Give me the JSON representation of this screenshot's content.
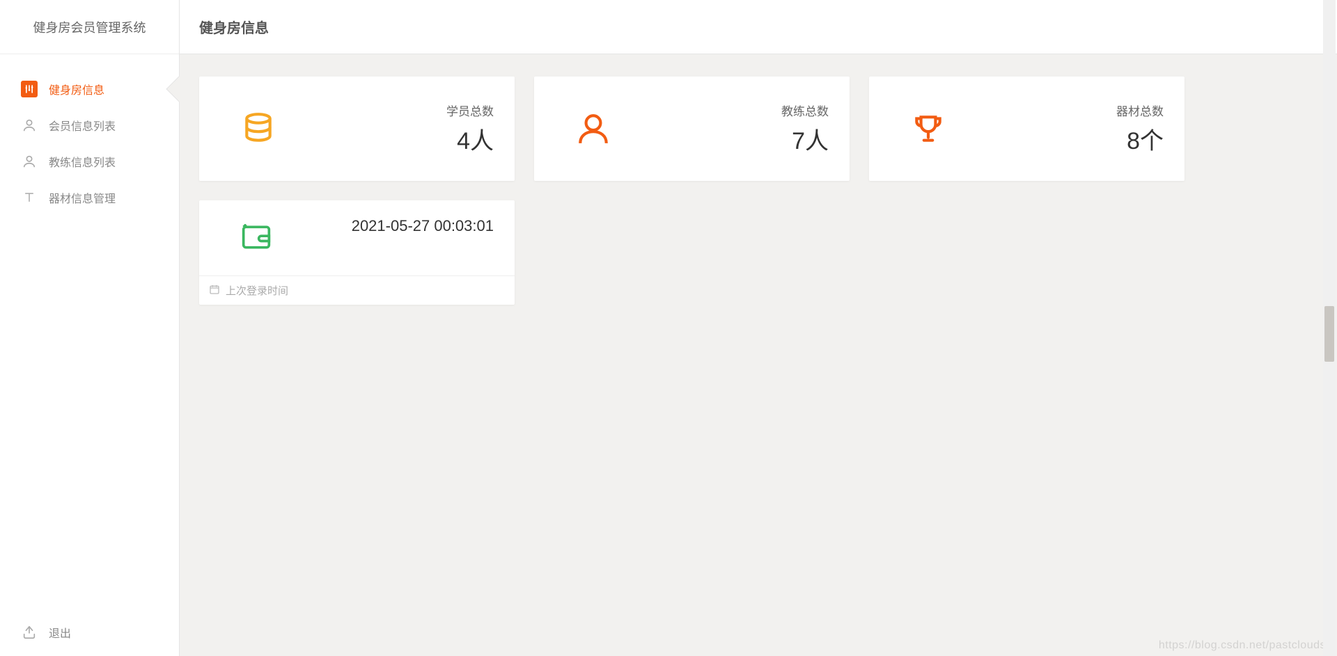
{
  "app": {
    "title": "健身房会员管理系统"
  },
  "sidebar": {
    "items": [
      {
        "label": "健身房信息"
      },
      {
        "label": "会员信息列表"
      },
      {
        "label": "教练信息列表"
      },
      {
        "label": "器材信息管理"
      }
    ],
    "logout": "退出"
  },
  "header": {
    "pageTitle": "健身房信息"
  },
  "stats": [
    {
      "label": "学员总数",
      "value": "4人"
    },
    {
      "label": "教练总数",
      "value": "7人"
    },
    {
      "label": "器材总数",
      "value": "8个"
    }
  ],
  "login": {
    "time": "2021-05-27 00:03:01",
    "label": "上次登录时间"
  },
  "watermark": "https://blog.csdn.net/pastclouds"
}
